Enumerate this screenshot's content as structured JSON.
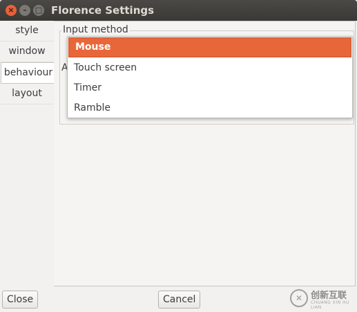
{
  "window": {
    "title": "Florence Settings",
    "close_glyph": "×",
    "minimize_glyph": "–",
    "maximize_glyph": "□"
  },
  "tabs": [
    {
      "label": "style"
    },
    {
      "label": "window"
    },
    {
      "label": "behaviour"
    },
    {
      "label": "layout"
    }
  ],
  "active_tab": "behaviour",
  "input_method": {
    "group_label": "Input method",
    "options": [
      {
        "label": "Mouse",
        "selected": true
      },
      {
        "label": "Touch screen"
      },
      {
        "label": "Timer"
      },
      {
        "label": "Ramble"
      }
    ]
  },
  "obscured_group_label": "A",
  "buttons": {
    "close": "Close",
    "cancel": "Cancel"
  },
  "watermark": {
    "text": "创新互联",
    "sub": "CHUANG XIN HU LIAN",
    "icon": "logo-icon"
  },
  "colors": {
    "accent": "#e8673a",
    "titlebar": "#3c3b37"
  }
}
